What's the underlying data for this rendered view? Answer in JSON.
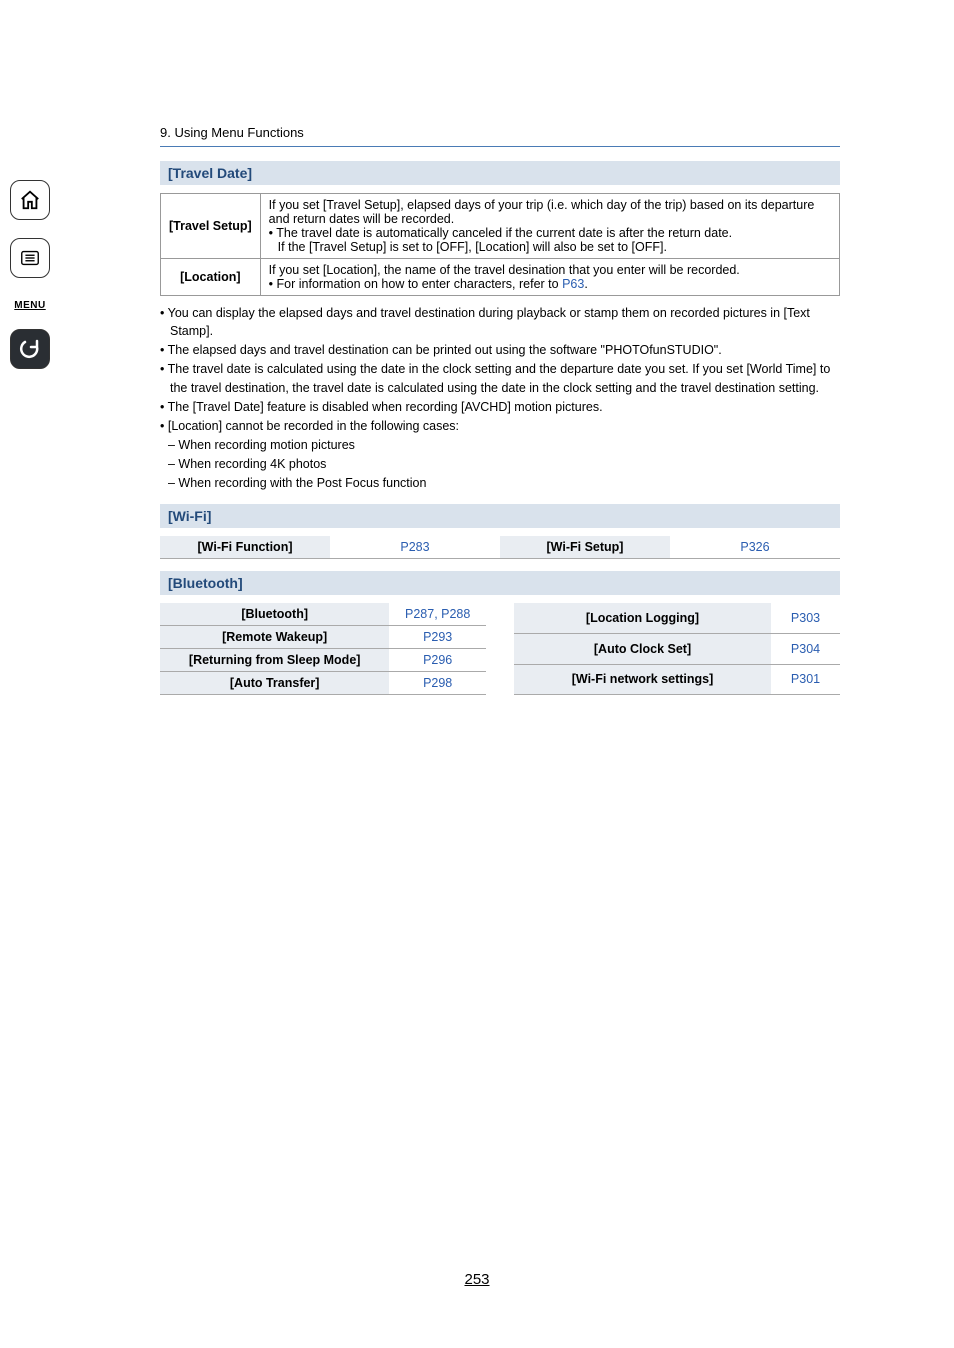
{
  "chapter": "9. Using Menu Functions",
  "travelDate": {
    "header": "[Travel Date]",
    "rows": [
      {
        "label": "[Travel Setup]",
        "lines": [
          "If you set [Travel Setup], elapsed days of your trip (i.e. which day of the trip) based on its departure and return dates will be recorded.",
          "• The travel date is automatically canceled if the current date is after the return date.",
          "If the [Travel Setup] is set to [OFF], [Location] will also be set to [OFF]."
        ]
      },
      {
        "label": "[Location]",
        "lines": [
          "If you set [Location], the name of the travel desination that you enter will be recorded.",
          "• For information on how to enter characters, refer to "
        ],
        "trailingLink": "P63",
        "trailingAfter": "."
      }
    ]
  },
  "notes": [
    {
      "txt": "• You can display the elapsed days and travel destination during playback or stamp them on recorded pictures in [Text Stamp]."
    },
    {
      "txt": "• The elapsed days and travel destination can be printed out using the software \"PHOTOfunSTUDIO\"."
    },
    {
      "txt": "• The travel date is calculated using the date in the clock setting and the departure date you set. If you set [World Time] to the travel destination, the travel date is calculated using the date in the clock setting and the travel destination setting."
    },
    {
      "txt": "• The [Travel Date] feature is disabled when recording [AVCHD] motion pictures."
    },
    {
      "txt": "• [Location] cannot be recorded in the following cases:"
    },
    {
      "txt": "– When recording motion pictures",
      "sub": true
    },
    {
      "txt": "– When recording 4K photos",
      "sub": true
    },
    {
      "txt": "– When recording with the Post Focus function",
      "sub": true
    }
  ],
  "wifi": {
    "header": "[Wi-Fi]",
    "cells": {
      "fnLabel": "[Wi-Fi Function]",
      "fnLink": "P283",
      "setupLabel": "[Wi-Fi Setup]",
      "setupLink": "P326"
    }
  },
  "bluetooth": {
    "header": "[Bluetooth]",
    "left": [
      {
        "label": "[Bluetooth]",
        "link": "P287, P288"
      },
      {
        "label": "[Remote Wakeup]",
        "link": "P293"
      },
      {
        "label": "[Returning from Sleep Mode]",
        "link": "P296"
      },
      {
        "label": "[Auto Transfer]",
        "link": "P298"
      }
    ],
    "right": [
      {
        "label": "[Location Logging]",
        "link": "P303"
      },
      {
        "label": "[Auto Clock Set]",
        "link": "P304"
      },
      {
        "label": "[Wi-Fi network settings]",
        "link": "P301"
      }
    ]
  },
  "pageNumber": "253",
  "sidebar": {
    "menuLabel": "MENU"
  }
}
